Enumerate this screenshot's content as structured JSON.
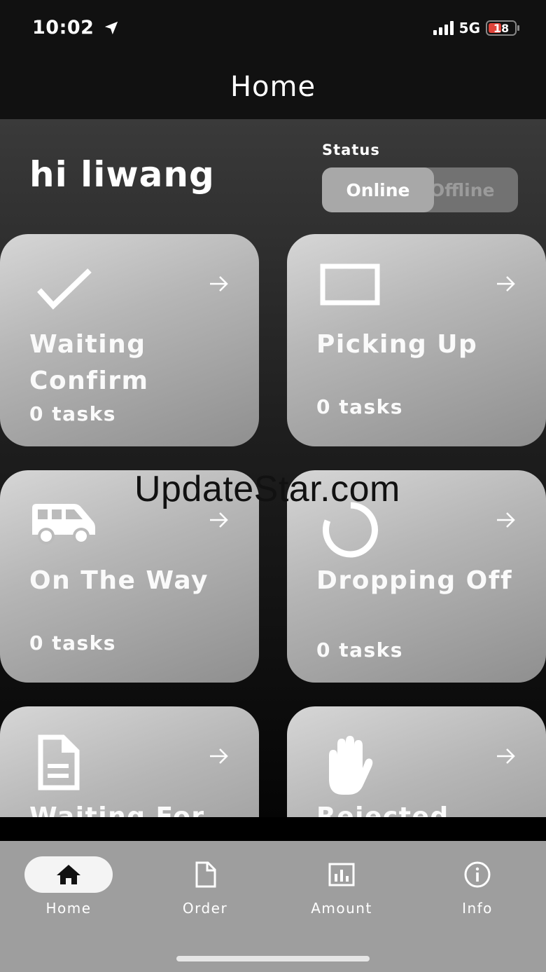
{
  "status_bar": {
    "time": "10:02",
    "network": "5G",
    "battery": "18"
  },
  "header": {
    "title": "Home"
  },
  "greeting": "hi liwang",
  "status_toggle": {
    "label": "Status",
    "online": "Online",
    "offline": "Offline",
    "selected": "Online"
  },
  "cards": [
    {
      "title": "Waiting Confirm",
      "count": "0 tasks",
      "icon": "check-icon"
    },
    {
      "title": "Picking Up",
      "count": "0 tasks",
      "icon": "rectangle-icon"
    },
    {
      "title": "On The Way",
      "count": "0 tasks",
      "icon": "van-icon"
    },
    {
      "title": "Dropping Off",
      "count": "0 tasks",
      "icon": "circle-loading-icon"
    },
    {
      "title": "Waiting For",
      "icon": "document-icon"
    },
    {
      "title": "Rejected",
      "icon": "hand-icon"
    }
  ],
  "watermark": "UpdateStar.com",
  "tabbar": {
    "active": "Home",
    "items": [
      {
        "label": "Home",
        "icon": "home-icon"
      },
      {
        "label": "Order",
        "icon": "file-icon"
      },
      {
        "label": "Amount",
        "icon": "chart-icon"
      },
      {
        "label": "Info",
        "icon": "info-icon"
      }
    ]
  },
  "colors": {
    "header_bg": "#111111",
    "card_bg": "#c4c4c4",
    "tabbar_bg": "#9e9e9e",
    "battery_low": "#e0433a"
  }
}
